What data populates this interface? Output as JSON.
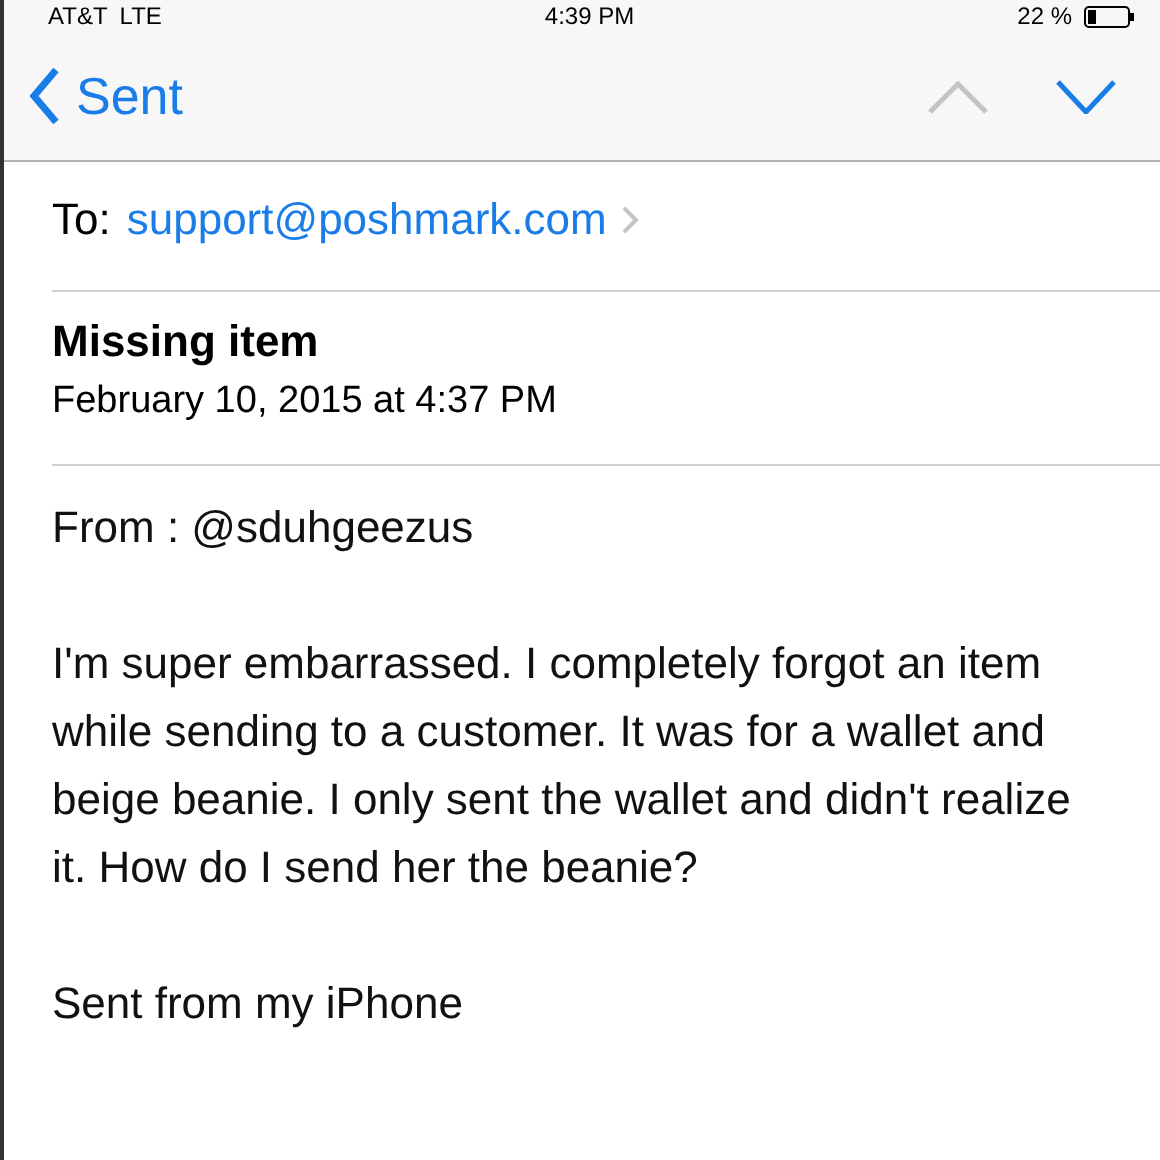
{
  "status_bar": {
    "carrier": "AT&T",
    "network": "LTE",
    "time": "4:39 PM",
    "battery": "22 %"
  },
  "nav": {
    "back_label": "Sent",
    "previous_disabled": true,
    "next_disabled": false
  },
  "recipient": {
    "label": "To:",
    "address": "support@poshmark.com"
  },
  "subject": "Missing item",
  "date": "February 10, 2015 at 4:37 PM",
  "body": [
    "From : @sduhgeezus",
    "I'm super embarrassed. I completely forgot an item while sending to a customer. It was for a wallet and beige beanie. I only sent the wallet and didn't realize it. How do I send her the beanie?",
    "Sent from my iPhone"
  ]
}
